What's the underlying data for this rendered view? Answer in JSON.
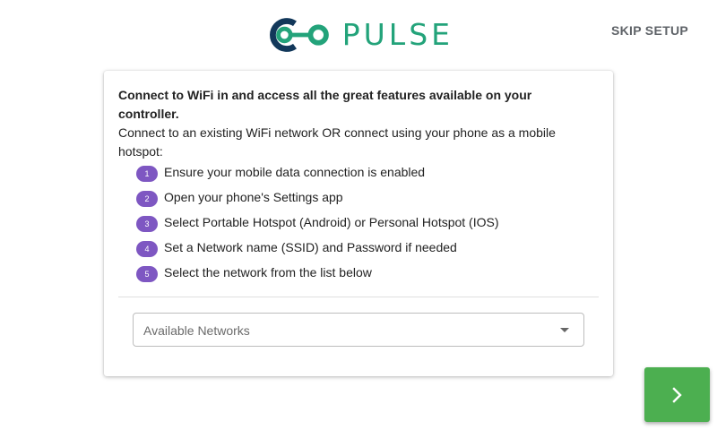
{
  "header": {
    "logo_text": "PULSE",
    "skip_label": "SKIP SETUP"
  },
  "card": {
    "intro_bold": "Connect to WiFi in and access all the great features available on your controller.",
    "intro_text": "Connect to an existing WiFi network OR connect using your phone as a mobile hotspot:",
    "steps": [
      {
        "num": "1",
        "text": "Ensure your mobile data connection is enabled"
      },
      {
        "num": "2",
        "text": "Open your phone's Settings app"
      },
      {
        "num": "3",
        "text": "Select Portable Hotspot (Android) or Personal Hotspot (IOS)"
      },
      {
        "num": "4",
        "text": "Set a Network name (SSID) and Password if needed"
      },
      {
        "num": "5",
        "text": "Select the network from the list below"
      }
    ],
    "network_select": {
      "label": "Available Networks"
    }
  },
  "next_button": {
    "icon": "chevron-right-icon"
  },
  "colors": {
    "brand_green": "#23a37a",
    "brand_navy": "#12385a",
    "step_badge": "#7e57c2",
    "next_button": "#4caf50"
  }
}
